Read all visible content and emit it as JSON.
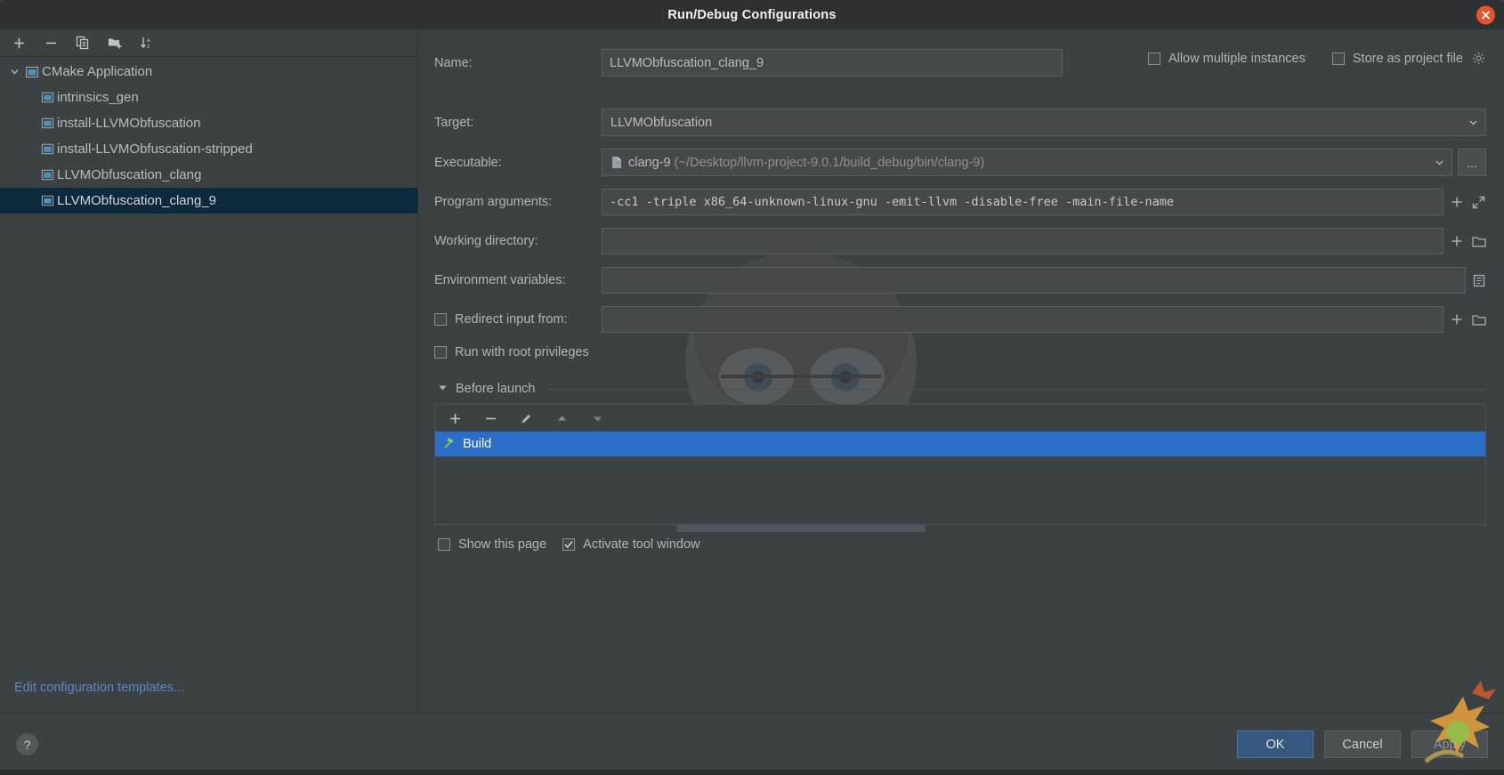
{
  "window": {
    "title": "Run/Debug Configurations",
    "close_icon": "close-icon"
  },
  "left_panel": {
    "toolbar": [
      {
        "name": "add-configuration-button",
        "icon": "plus-icon",
        "label": "+"
      },
      {
        "name": "remove-configuration-button",
        "icon": "minus-icon",
        "label": "−"
      },
      {
        "name": "copy-configuration-button",
        "icon": "copy-icon",
        "label": "Copy"
      },
      {
        "name": "new-folder-button",
        "icon": "new-folder-icon",
        "label": "New Folder"
      },
      {
        "name": "sort-configurations-button",
        "icon": "sort-alpha-icon",
        "label": "Sort"
      }
    ],
    "tree": {
      "group_label": "CMake Application",
      "items": [
        {
          "label": "intrinsics_gen",
          "selected": false
        },
        {
          "label": "install-LLVMObfuscation",
          "selected": false
        },
        {
          "label": "install-LLVMObfuscation-stripped",
          "selected": false
        },
        {
          "label": "LLVMObfuscation_clang",
          "selected": false
        },
        {
          "label": "LLVMObfuscation_clang_9",
          "selected": true
        }
      ]
    },
    "edit_templates_link": "Edit configuration templates..."
  },
  "form": {
    "name": {
      "label": "Name:",
      "value": "LLVMObfuscation_clang_9",
      "placeholder": "Name"
    },
    "allow_multiple_instances": {
      "label": "Allow multiple instances",
      "checked": false
    },
    "store_as_project_file": {
      "label": "Store as project file",
      "checked": false,
      "gear_icon": "gear-icon"
    },
    "target": {
      "label": "Target:",
      "value": "LLVMObfuscation"
    },
    "executable": {
      "label": "Executable:",
      "value": "clang-9",
      "path": "(~/Desktop/llvm-project-9.0.1/build_debug/bin/clang-9)",
      "browse_label": "..."
    },
    "program_arguments": {
      "label": "Program arguments:",
      "value": "-cc1 -triple x86_64-unknown-linux-gnu -emit-llvm -disable-free -main-file-name"
    },
    "working_directory": {
      "label": "Working directory:",
      "value": ""
    },
    "environment_variables": {
      "label": "Environment variables:",
      "value": ""
    },
    "redirect_input_from": {
      "label": "Redirect input from:",
      "checked": false,
      "value": ""
    },
    "run_with_root_privileges": {
      "label": "Run with root privileges",
      "checked": false
    }
  },
  "before_launch": {
    "title": "Before launch",
    "expanded": true,
    "toolbar": [
      {
        "name": "add-task-button",
        "icon": "plus-icon"
      },
      {
        "name": "remove-task-button",
        "icon": "minus-icon"
      },
      {
        "name": "edit-task-button",
        "icon": "pencil-icon"
      },
      {
        "name": "move-task-up-button",
        "icon": "arrow-up-icon"
      },
      {
        "name": "move-task-down-button",
        "icon": "arrow-down-icon"
      }
    ],
    "tasks": [
      {
        "label": "Build",
        "icon": "hammer-icon",
        "selected": true
      }
    ],
    "show_this_page": {
      "label": "Show this page",
      "checked": false
    },
    "activate_tool_window": {
      "label": "Activate tool window",
      "checked": true
    }
  },
  "footer": {
    "help_label": "?",
    "buttons": [
      {
        "name": "ok-button",
        "label": "OK",
        "primary": true,
        "disabled": false
      },
      {
        "name": "cancel-button",
        "label": "Cancel",
        "primary": false,
        "disabled": false
      },
      {
        "name": "apply-button",
        "label": "Apply",
        "primary": false,
        "disabled": true
      }
    ]
  },
  "colors": {
    "accent_selection": "#2a6ec9",
    "tree_selection": "#0d293e",
    "link": "#5e86c4",
    "close": "#e8542a",
    "primary_button": "#365880"
  }
}
